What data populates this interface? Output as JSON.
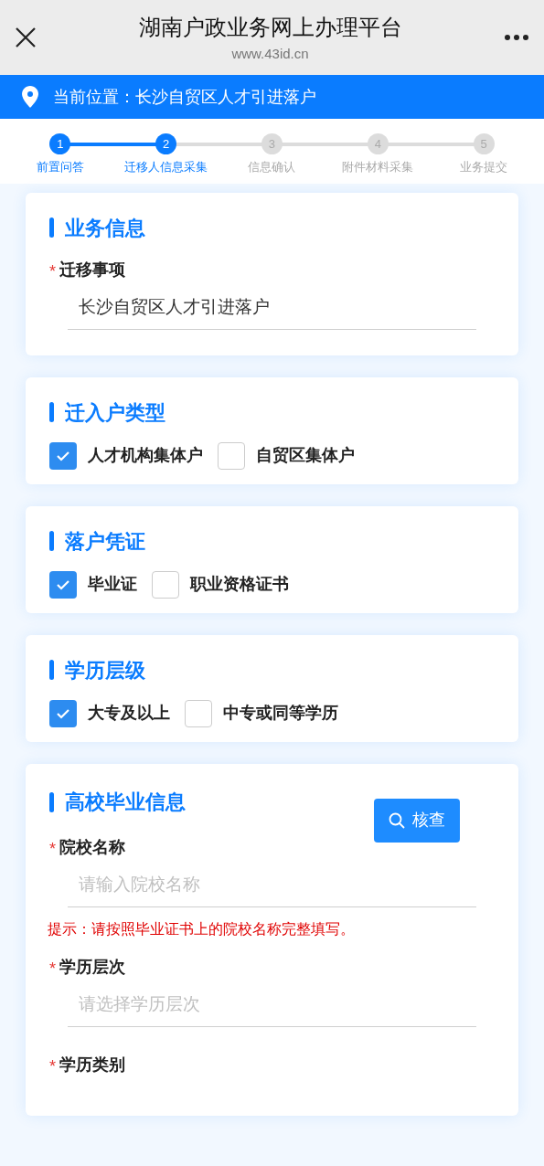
{
  "header": {
    "title": "湖南户政业务网上办理平台",
    "subtitle": "www.43id.cn"
  },
  "location": "当前位置：长沙自贸区人才引进落户",
  "steps": [
    {
      "number": "1",
      "label": "前置问答",
      "active": true
    },
    {
      "number": "2",
      "label": "迁移人信息采集",
      "active": true
    },
    {
      "number": "3",
      "label": "信息确认",
      "active": false
    },
    {
      "number": "4",
      "label": "附件材料采集",
      "active": false
    },
    {
      "number": "5",
      "label": "业务提交",
      "active": false
    }
  ],
  "sections": [
    {
      "title": "业务信息",
      "fields": [
        {
          "kind": "field",
          "label": "迁移事项",
          "mark": "*",
          "value": "长沙自贸区人才引进落户"
        }
      ]
    },
    {
      "title": "迁入户类型",
      "fields": [
        {
          "kind": "checkboxes",
          "options": [
            {
              "label": "人才机构集体户",
              "checked": true
            },
            {
              "label": "自贸区集体户",
              "checked": false
            }
          ]
        }
      ]
    },
    {
      "title": "落户凭证",
      "fields": [
        {
          "kind": "checkboxes",
          "options": [
            {
              "label": "毕业证",
              "checked": true
            },
            {
              "label": "职业资格证书",
              "checked": false
            }
          ]
        }
      ]
    },
    {
      "title": "学历层级",
      "fields": [
        {
          "kind": "checkboxes",
          "options": [
            {
              "label": "大专及以上",
              "checked": true
            },
            {
              "label": "中专或同等学历",
              "checked": false
            }
          ]
        }
      ]
    },
    {
      "title": "高校毕业信息",
      "button": "核查",
      "fields": [
        {
          "kind": "field",
          "label": "院校名称",
          "mark": "*",
          "placeholder": "请输入院校名称"
        },
        {
          "kind": "hint",
          "text": "提示：请按照毕业证书上的院校名称完整填写。"
        },
        {
          "kind": "field",
          "label": "学历层次",
          "mark": "*",
          "placeholder": "请选择学历层次"
        },
        {
          "kind": "field",
          "label": "学历类别",
          "mark": "*"
        }
      ]
    }
  ]
}
